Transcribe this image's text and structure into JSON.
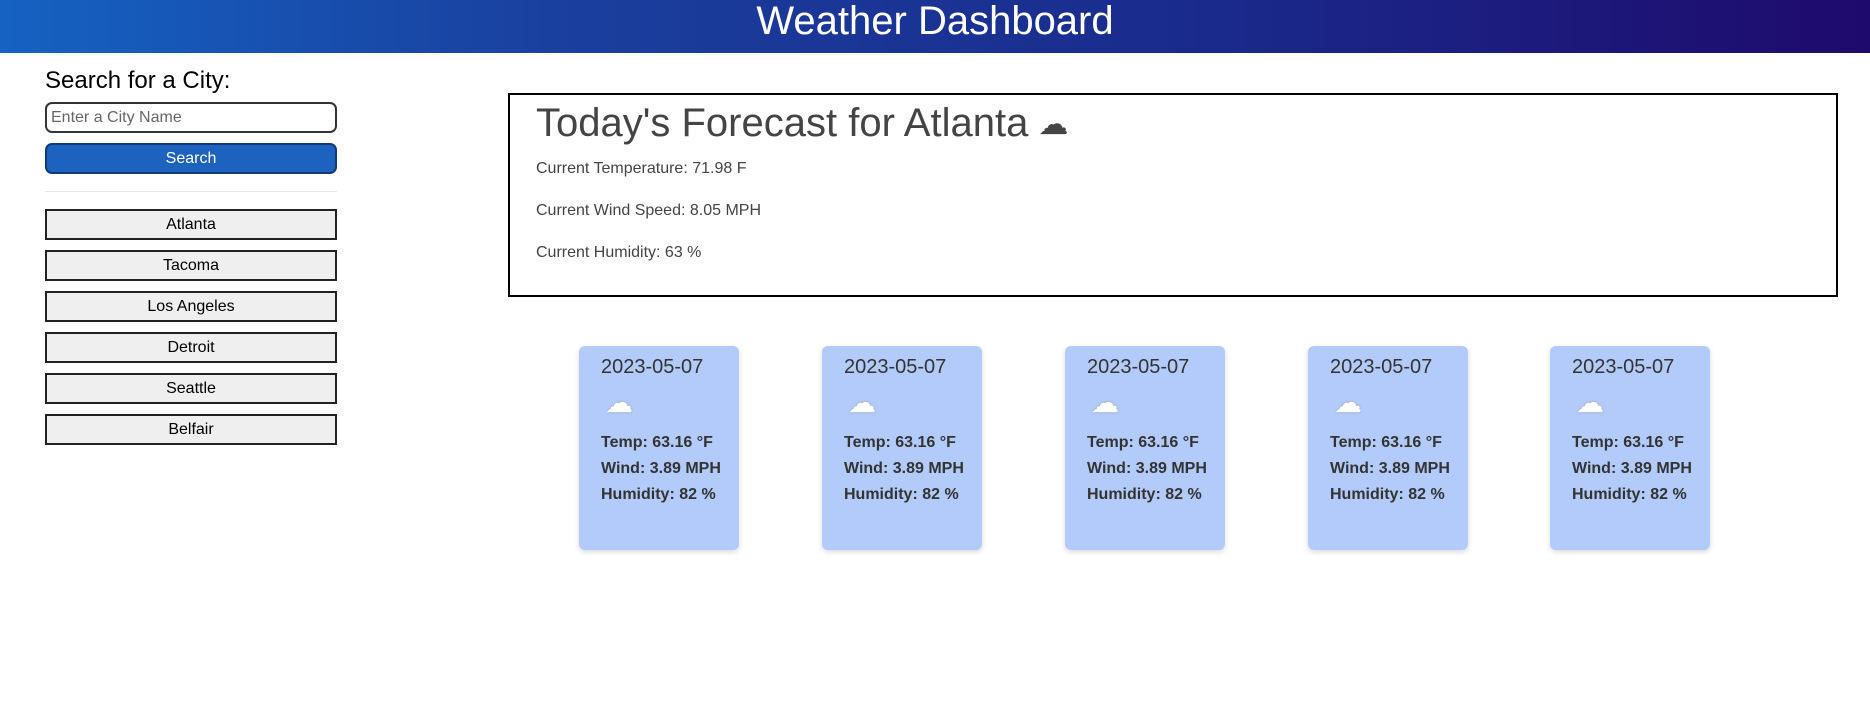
{
  "header": {
    "title": "Weather Dashboard"
  },
  "sidebar": {
    "title": "Search for a City:",
    "input_placeholder": "Enter a City Name",
    "input_value": "",
    "search_label": "Search",
    "history": [
      "Atlanta",
      "Tacoma",
      "Los Angeles",
      "Detroit",
      "Seattle",
      "Belfair"
    ]
  },
  "today": {
    "title": "Today's Forecast for Atlanta",
    "icon": "☁",
    "icon_name": "cloudy-icon",
    "temperature": "Current Temperature: 71.98 F",
    "wind": "Current Wind Speed: 8.05 MPH",
    "humidity": "Current Humidity: 63 %"
  },
  "forecast": [
    {
      "date": "2023-05-07",
      "icon": "☁",
      "temp": "Temp: 63.16 °F",
      "wind": "Wind: 3.89 MPH",
      "humidity": "Humidity: 82 %"
    },
    {
      "date": "2023-05-07",
      "icon": "☁",
      "temp": "Temp: 63.16 °F",
      "wind": "Wind: 3.89 MPH",
      "humidity": "Humidity: 82 %"
    },
    {
      "date": "2023-05-07",
      "icon": "☁",
      "temp": "Temp: 63.16 °F",
      "wind": "Wind: 3.89 MPH",
      "humidity": "Humidity: 82 %"
    },
    {
      "date": "2023-05-07",
      "icon": "☁",
      "temp": "Temp: 63.16 °F",
      "wind": "Wind: 3.89 MPH",
      "humidity": "Humidity: 82 %"
    },
    {
      "date": "2023-05-07",
      "icon": "☁",
      "temp": "Temp: 63.16 °F",
      "wind": "Wind: 3.89 MPH",
      "humidity": "Humidity: 82 %"
    }
  ],
  "colors": {
    "header_start": "#1562c2",
    "header_end": "#1e0a6c",
    "search_button": "#1e62c0",
    "card_background": "#b2cbfb"
  }
}
